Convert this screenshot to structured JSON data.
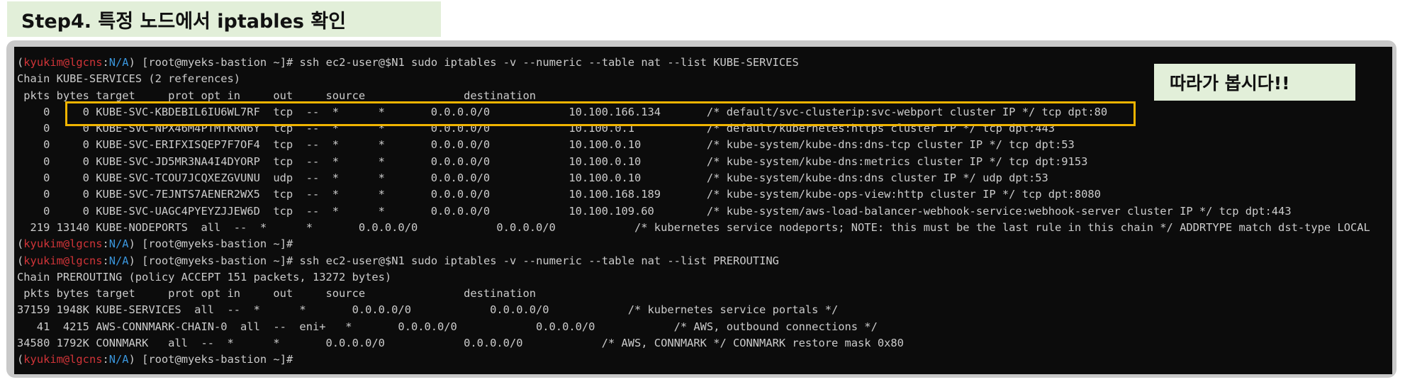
{
  "header": {
    "step_title": "Step4. 특정 노드에서 iptables 확인"
  },
  "callout": {
    "text": "따라가 봅시다!!"
  },
  "prompt": {
    "user": "kyukim@lgcns",
    "na": "N/A",
    "rest": ") [root@myeks-bastion ~]# "
  },
  "terminal": {
    "cmd1": "ssh ec2-user@$N1 sudo iptables -v --numeric --table nat --list KUBE-SERVICES",
    "chain1": "Chain KUBE-SERVICES (2 references)",
    "header1": " pkts bytes target     prot opt in     out     source               destination",
    "rows1": [
      "    0     0 KUBE-SVC-KBDEBIL6IU6WL7RF  tcp  --  *      *       0.0.0.0/0            10.100.166.134       /* default/svc-clusterip:svc-webport cluster IP */ tcp dpt:80",
      "    0     0 KUBE-SVC-NPX46M4PTMTKRN6Y  tcp  --  *      *       0.0.0.0/0            10.100.0.1           /* default/kubernetes:https cluster IP */ tcp dpt:443",
      "    0     0 KUBE-SVC-ERIFXISQEP7F7OF4  tcp  --  *      *       0.0.0.0/0            10.100.0.10          /* kube-system/kube-dns:dns-tcp cluster IP */ tcp dpt:53",
      "    0     0 KUBE-SVC-JD5MR3NA4I4DYORP  tcp  --  *      *       0.0.0.0/0            10.100.0.10          /* kube-system/kube-dns:metrics cluster IP */ tcp dpt:9153",
      "    0     0 KUBE-SVC-TCOU7JCQXEZGVUNU  udp  --  *      *       0.0.0.0/0            10.100.0.10          /* kube-system/kube-dns:dns cluster IP */ udp dpt:53",
      "    0     0 KUBE-SVC-7EJNTS7AENER2WX5  tcp  --  *      *       0.0.0.0/0            10.100.168.189       /* kube-system/kube-ops-view:http cluster IP */ tcp dpt:8080",
      "    0     0 KUBE-SVC-UAGC4PYEYZJJEW6D  tcp  --  *      *       0.0.0.0/0            10.100.109.60        /* kube-system/aws-load-balancer-webhook-service:webhook-server cluster IP */ tcp dpt:443",
      "  219 13140 KUBE-NODEPORTS  all  --  *      *       0.0.0.0/0            0.0.0.0/0            /* kubernetes service nodeports; NOTE: this must be the last rule in this chain */ ADDRTYPE match dst-type LOCAL"
    ],
    "cmd2": "ssh ec2-user@$N1 sudo iptables -v --numeric --table nat --list PREROUTING",
    "chain2": "Chain PREROUTING (policy ACCEPT 151 packets, 13272 bytes)",
    "header2": " pkts bytes target     prot opt in     out     source               destination",
    "rows2": [
      "37159 1948K KUBE-SERVICES  all  --  *      *       0.0.0.0/0            0.0.0.0/0            /* kubernetes service portals */",
      "   41  4215 AWS-CONNMARK-CHAIN-0  all  --  eni+   *       0.0.0.0/0            0.0.0.0/0            /* AWS, outbound connections */",
      "34580 1792K CONNMARK   all  --  *      *       0.0.0.0/0            0.0.0.0/0            /* AWS, CONNMARK */ CONNMARK restore mask 0x80"
    ]
  },
  "colors": {
    "terminal_bg": "#0c0c0c",
    "terminal_text": "#cccccc",
    "prompt_red": "#d13438",
    "prompt_blue": "#3a96dd",
    "highlight": "#f0b400",
    "label_bg": "#e2efd9"
  }
}
